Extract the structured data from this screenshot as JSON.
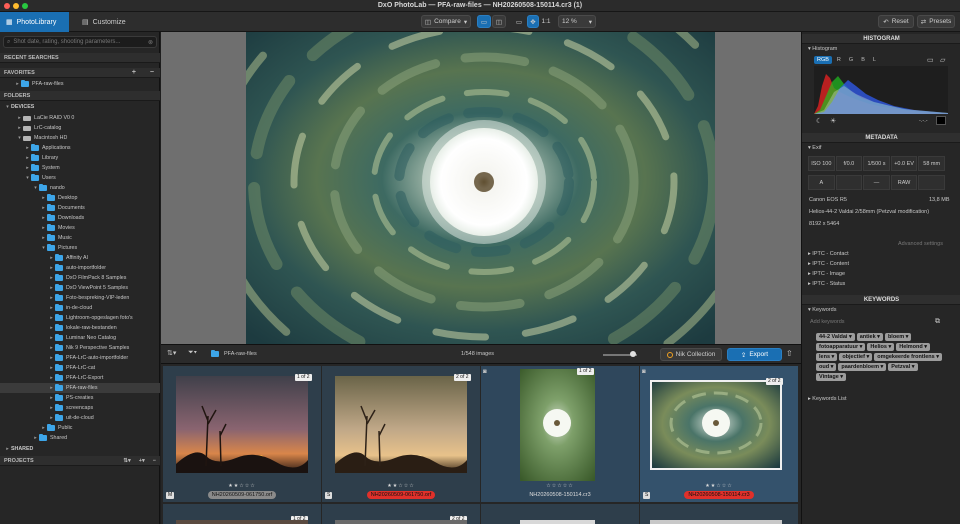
{
  "window": {
    "title": "DxO PhotoLab — PFA-raw-files — NH20260508-150114.cr3 (1)"
  },
  "toolbar": {
    "tab_library": "PhotoLibrary",
    "tab_customize": "Customize",
    "compare": "Compare",
    "one_to_one": "1:1",
    "zoom": "12 %",
    "reset": "Reset",
    "presets": "Presets"
  },
  "left": {
    "search_placeholder": "Shot date, rating, shooting parameters...",
    "recent_searches": "RECENT SEARCHES",
    "favorites": "FAVORITES",
    "favorites_item": "PFA-raw-files",
    "folders": "FOLDERS",
    "devices": "DEVICES",
    "tree": [
      {
        "label": "LaCie RAID V0 0",
        "indent": 2,
        "icon": "drive",
        "caret": "▸"
      },
      {
        "label": "LrC-catalog",
        "indent": 2,
        "icon": "drive",
        "caret": "▸"
      },
      {
        "label": "Macintosh HD",
        "indent": 2,
        "icon": "drive",
        "caret": "▾"
      },
      {
        "label": "Applications",
        "indent": 3,
        "icon": "folder",
        "caret": "▸"
      },
      {
        "label": "Library",
        "indent": 3,
        "icon": "folder",
        "caret": "▸"
      },
      {
        "label": "System",
        "indent": 3,
        "icon": "folder",
        "caret": "▸"
      },
      {
        "label": "Users",
        "indent": 3,
        "icon": "folder",
        "caret": "▾"
      },
      {
        "label": "nando",
        "indent": 4,
        "icon": "folder",
        "caret": "▾"
      },
      {
        "label": "Desktop",
        "indent": 5,
        "icon": "folder",
        "caret": "▸"
      },
      {
        "label": "Documents",
        "indent": 5,
        "icon": "folder",
        "caret": "▸"
      },
      {
        "label": "Downloads",
        "indent": 5,
        "icon": "folder",
        "caret": "▸"
      },
      {
        "label": "Movies",
        "indent": 5,
        "icon": "folder",
        "caret": "▸"
      },
      {
        "label": "Music",
        "indent": 5,
        "icon": "folder",
        "caret": "▸"
      },
      {
        "label": "Pictures",
        "indent": 5,
        "icon": "folder",
        "caret": "▾"
      },
      {
        "label": "Affinity AI",
        "indent": 6,
        "icon": "folder",
        "caret": "▸"
      },
      {
        "label": "auto-importfolder",
        "indent": 6,
        "icon": "folder",
        "caret": "▸"
      },
      {
        "label": "DxO FilmPack 8 Samples",
        "indent": 6,
        "icon": "folder",
        "caret": "▸"
      },
      {
        "label": "DxO ViewPoint 5 Samples",
        "indent": 6,
        "icon": "folder",
        "caret": "▸"
      },
      {
        "label": "Foto-bespreking-VIP-leden",
        "indent": 6,
        "icon": "folder",
        "caret": "▸"
      },
      {
        "label": "in-de-cloud",
        "indent": 6,
        "icon": "folder",
        "caret": "▸"
      },
      {
        "label": "Lightroom-opgeslagen foto's",
        "indent": 6,
        "icon": "folder",
        "caret": "▸"
      },
      {
        "label": "lokale-raw-bestanden",
        "indent": 6,
        "icon": "folder",
        "caret": "▸"
      },
      {
        "label": "Luminar Neo Catalog",
        "indent": 6,
        "icon": "folder",
        "caret": "▸"
      },
      {
        "label": "Nik 9 Perspective Samples",
        "indent": 6,
        "icon": "folder",
        "caret": "▸"
      },
      {
        "label": "PFA-LrC-auto-importfolder",
        "indent": 6,
        "icon": "folder",
        "caret": "▸"
      },
      {
        "label": "PFA-LrC-cat",
        "indent": 6,
        "icon": "folder",
        "caret": "▸"
      },
      {
        "label": "PFA-LrC-Export",
        "indent": 6,
        "icon": "folder",
        "caret": "▸"
      },
      {
        "label": "PFA-raw-files",
        "indent": 6,
        "icon": "folder",
        "caret": "▸",
        "selected": true
      },
      {
        "label": "PS-creaties",
        "indent": 6,
        "icon": "folder",
        "caret": "▸"
      },
      {
        "label": "screencaps",
        "indent": 6,
        "icon": "folder",
        "caret": "▸"
      },
      {
        "label": "uit-de-cloud",
        "indent": 6,
        "icon": "folder",
        "caret": "▸"
      },
      {
        "label": "Public",
        "indent": 5,
        "icon": "folder",
        "caret": "▸"
      },
      {
        "label": "Shared",
        "indent": 4,
        "icon": "folder",
        "caret": "▸"
      }
    ],
    "shared": "SHARED",
    "projects": "PROJECTS"
  },
  "filmbar": {
    "folder_name": "PFA-raw-files",
    "count": "1/548 images",
    "nik": "Nik Collection",
    "export": "Export"
  },
  "thumbs": [
    {
      "name": "NH20260509-061750.orf",
      "badge": "1 of 2",
      "tag": "M",
      "name_style": "grey"
    },
    {
      "name": "NH20260509-061750.orf",
      "badge": "2 of 2",
      "tag": "S",
      "name_style": "red"
    },
    {
      "name": "NH20260508-150114.cr3",
      "badge": "1 of 2",
      "tag": "",
      "name_style": "plain"
    },
    {
      "name": "NH20260508-150114.cr3",
      "badge": "2 of 2",
      "tag": "S",
      "name_style": "red"
    }
  ],
  "thumbs_row2_badges": [
    "1 of 2",
    "2 of 2"
  ],
  "right": {
    "histogram_title": "HISTOGRAM",
    "histogram_sub": "Histogram",
    "channels": [
      "RGB",
      "R",
      "G",
      "B",
      "L"
    ],
    "metadata_title": "METADATA",
    "exif": "Exif",
    "exif_cells": [
      "ISO 100",
      "f/0.0",
      "1/500 s",
      "+0.0 EV",
      "58 mm"
    ],
    "exif_cells2": [
      "A",
      "",
      "—",
      "RAW",
      ""
    ],
    "camera": "Canon EOS R5",
    "size": "13,8 MB",
    "lens": "Helios-44-2 Valdai 2/58mm (Petzval modification)",
    "dimensions": "8192 x 5464",
    "advanced": "Advanced settings",
    "iptc": [
      "IPTC - Contact",
      "IPTC - Content",
      "IPTC - Image",
      "IPTC - Status"
    ],
    "keywords_title": "KEYWORDS",
    "keywords_sub": "Keywords",
    "add_keywords": "Add keywords",
    "keywords": [
      "44-2 Valdai",
      "antiek",
      "bloem",
      "fotoapparatuur",
      "Helios",
      "Helmond",
      "lens",
      "objectief",
      "omgekeerde frontlens",
      "oud",
      "paardenbloem",
      "Petzval",
      "Vintage"
    ],
    "keywords_list": "Keywords List"
  }
}
